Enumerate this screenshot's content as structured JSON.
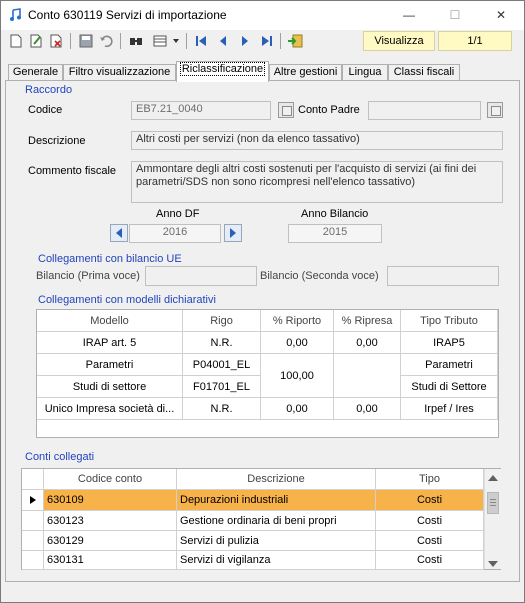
{
  "window": {
    "title": "Conto 630119 Servizi di importazione"
  },
  "toolbar": {
    "view_label": "Visualizza",
    "page_counter": "1/1"
  },
  "tabs": [
    {
      "label": "Generale"
    },
    {
      "label": "Filtro visualizzazione"
    },
    {
      "label": "Riclassificazione"
    },
    {
      "label": "Altre gestioni"
    },
    {
      "label": "Lingua"
    },
    {
      "label": "Classi fiscali"
    }
  ],
  "raccordo": {
    "title": "Raccordo",
    "codice_label": "Codice",
    "codice_value": "EB7.21_0040",
    "conto_padre_label": "Conto Padre",
    "conto_padre_value": "",
    "descrizione_label": "Descrizione",
    "descrizione_value": "Altri costi per servizi (non da elenco tassativo)",
    "commento_label": "Commento fiscale",
    "commento_value": "Ammontare degli altri costi sostenuti per l'acquisto di servizi (ai fini dei parametri/SDS non sono ricompresi nell'elenco tassativo)",
    "anno_df_label": "Anno DF",
    "anno_df_value": "2016",
    "anno_bilancio_label": "Anno Bilancio",
    "anno_bilancio_value": "2015"
  },
  "bilancio_ue": {
    "title": "Collegamenti con bilancio UE",
    "prima_label": "Bilancio (Prima voce)",
    "prima_value": "",
    "seconda_label": "Bilancio (Seconda voce)",
    "seconda_value": ""
  },
  "modelli": {
    "title": "Collegamenti con modelli dichiarativi",
    "headers": [
      "Modello",
      "Rigo",
      "% Riporto",
      "% Ripresa",
      "Tipo Tributo"
    ],
    "rows": [
      {
        "modello": "IRAP art. 5",
        "rigo": "N.R.",
        "riporto": "0,00",
        "ripresa": "0,00",
        "tipo": "IRAP5"
      },
      {
        "modello": "Parametri",
        "rigo": "P04001_EL",
        "riporto": "100,00",
        "ripresa": "",
        "tipo": "Parametri"
      },
      {
        "modello": "Studi di settore",
        "rigo": "F01701_EL",
        "riporto": "",
        "ripresa": "",
        "tipo": "Studi di Settore"
      },
      {
        "modello": "Unico Impresa società di...",
        "rigo": "N.R.",
        "riporto": "0,00",
        "ripresa": "0,00",
        "tipo": "Irpef / Ires"
      }
    ]
  },
  "conti": {
    "title": "Conti collegati",
    "headers": [
      "Codice conto",
      "Descrizione",
      "Tipo"
    ],
    "rows": [
      {
        "codice": "630109",
        "descrizione": "Depurazioni industriali",
        "tipo": "Costi"
      },
      {
        "codice": "630123",
        "descrizione": "Gestione ordinaria di beni propri",
        "tipo": "Costi"
      },
      {
        "codice": "630129",
        "descrizione": "Servizi di pulizia",
        "tipo": "Costi"
      },
      {
        "codice": "630131",
        "descrizione": "Servizi di vigilanza",
        "tipo": "Costi"
      }
    ]
  },
  "colors": {
    "accent": "#2244bb",
    "selected_row": "#f7b24a",
    "toolbar_field": "#fff9c4"
  }
}
